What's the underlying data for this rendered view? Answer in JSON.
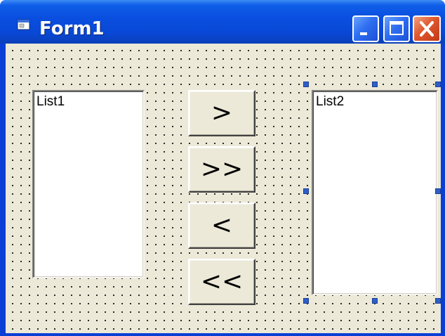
{
  "window": {
    "title": "Form1",
    "icon": "form-icon",
    "controls": {
      "minimize": "minimize-icon",
      "maximize": "maximize-icon",
      "close": "close-icon"
    }
  },
  "form": {
    "list1": {
      "label": "List1"
    },
    "list2": {
      "label": "List2",
      "selected": true
    },
    "buttons": [
      {
        "name": "move-right-button",
        "label": ">"
      },
      {
        "name": "move-all-right-button",
        "label": ">>"
      },
      {
        "name": "move-left-button",
        "label": "<"
      },
      {
        "name": "move-all-left-button",
        "label": "<<"
      }
    ]
  },
  "colors": {
    "titlebar": "#0a4fe0",
    "form_background": "#ece9d8",
    "close_button": "#e0572e",
    "selection_handle": "#2f5fc4"
  }
}
